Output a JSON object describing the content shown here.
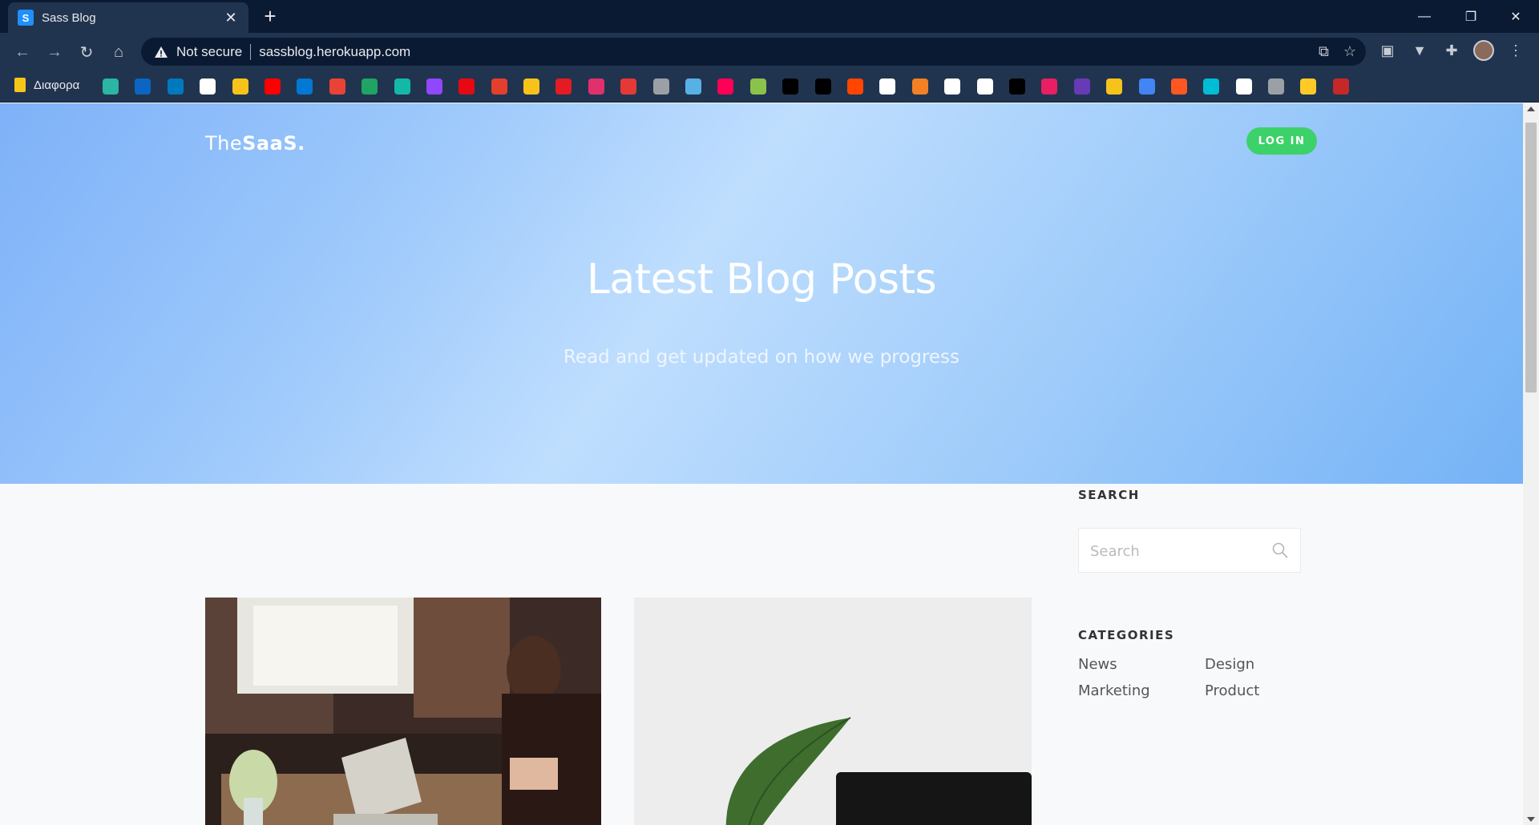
{
  "browser": {
    "tab_title": "Sass Blog",
    "tab_favicon_letter": "S",
    "not_secure_label": "Not secure",
    "url": "sassblog.herokuapp.com",
    "bookmark_folder": "Διαφορα",
    "bookmark_icons": [
      "#2bb5a3",
      "#0a66c2",
      "#0079bf",
      "#ffffff",
      "#f7c31a",
      "#ff0000",
      "#0078d4",
      "#ea4335",
      "#1fa463",
      "#14b8a6",
      "#9146ff",
      "#e50914",
      "#e43f2d",
      "#f7c31a",
      "#e31b23",
      "#e1306c",
      "#e53935",
      "#9aa0a6",
      "#58b1e5",
      "#ff0057",
      "#8bc34a",
      "#000000",
      "#000000",
      "#ff4500",
      "#ffffff",
      "#f48024",
      "#ffffff",
      "#ffffff",
      "#000000",
      "#e91e63",
      "#673ab7",
      "#f7c31a",
      "#4285f4",
      "#ff5722",
      "#00bcd4",
      "#ffffff",
      "#9aa0a6",
      "#ffca28",
      "#c62828"
    ]
  },
  "page": {
    "logo_light": "The",
    "logo_bold": "SaaS.",
    "login_label": "LOG IN",
    "hero_title": "Latest Blog Posts",
    "hero_subtitle": "Read and get updated on how we progress",
    "sidebar": {
      "search_heading": "SEARCH",
      "search_placeholder": "Search",
      "categories_heading": "CATEGORIES",
      "categories": [
        "News",
        "Design",
        "Marketing",
        "Product"
      ]
    }
  },
  "colors": {
    "login_button": "#3dd16a",
    "hero_gradient_center": "#bfdefe"
  }
}
